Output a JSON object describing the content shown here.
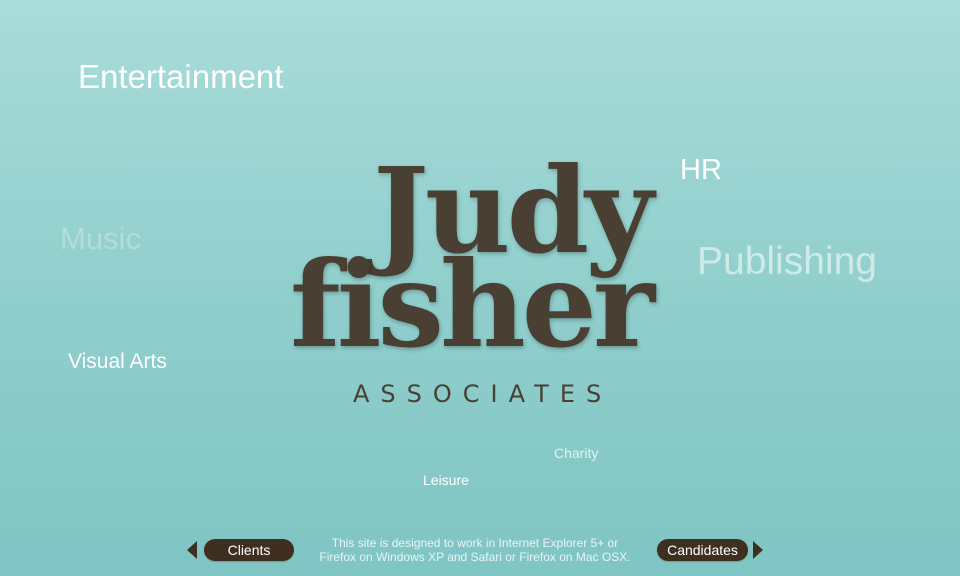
{
  "categories": {
    "entertainment": "Entertainment",
    "hr": "HR",
    "music": "Music",
    "publishing": "Publishing",
    "visual_arts": "Visual Arts",
    "charity": "Charity",
    "leisure": "Leisure"
  },
  "logo": {
    "line1": "Judy",
    "line2": "fisher",
    "subtitle": "ASSOCIATES"
  },
  "nav": {
    "clients_label": "Clients",
    "candidates_label": "Candidates",
    "left_arrow_icon": "triangle-left-icon",
    "right_arrow_icon": "triangle-right-icon"
  },
  "footer": {
    "line1": "This site is designed to work in Internet Explorer 5+ or",
    "line2": "Firefox on Windows XP and Safari or Firefox on Mac OSX."
  },
  "colors": {
    "background_top": "#a9dcda",
    "background_bottom": "#7fc5c3",
    "logo_brown": "#4a3f33",
    "button_brown": "#3f2f21"
  }
}
